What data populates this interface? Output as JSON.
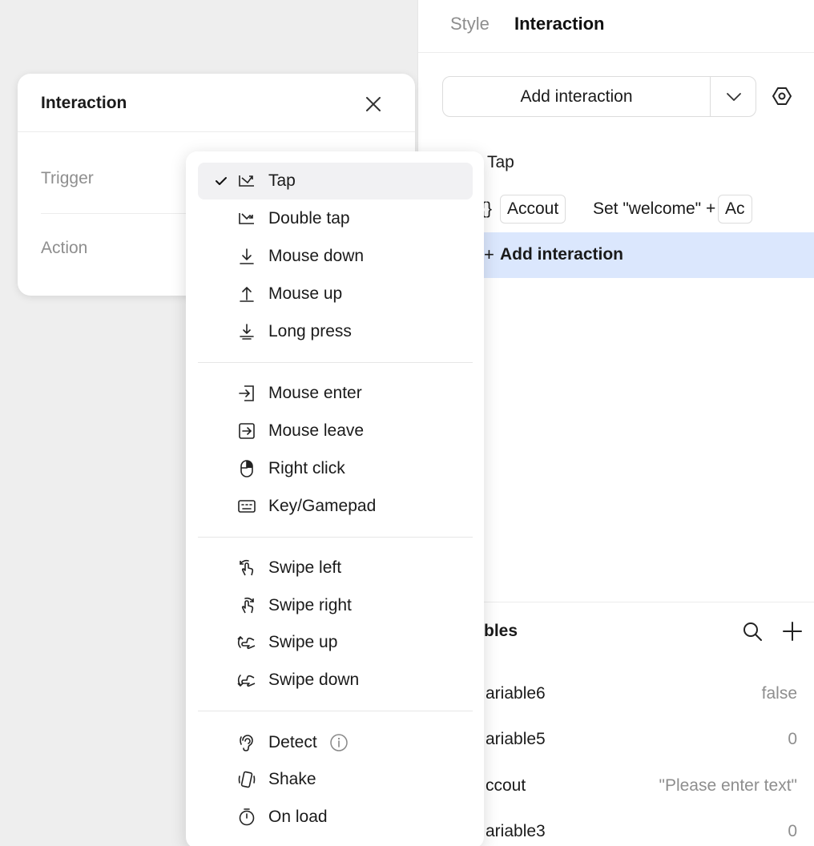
{
  "inspector": {
    "tabs": [
      "Style",
      "Interaction"
    ],
    "add_interaction_label": "Add interaction",
    "trigger_row": "Tap",
    "action_row": {
      "brace": "{}",
      "chip_1": "Accout",
      "text": "Set \"welcome\" +",
      "chip_2": "Ac"
    },
    "add_interaction_row": "Add interaction",
    "variables_title": "bles",
    "variables": [
      {
        "name": "ariable6",
        "value": "false"
      },
      {
        "name": "ariable5",
        "value": "0"
      },
      {
        "name": "ccout",
        "value": "\"Please enter text\""
      },
      {
        "name": "ariable3",
        "value": "0"
      }
    ]
  },
  "card": {
    "title": "Interaction",
    "trigger_label": "Trigger",
    "action_label": "Action"
  },
  "menu": {
    "selected": "Tap",
    "groups": [
      [
        {
          "label": "Tap",
          "icon": "tap-icon"
        },
        {
          "label": "Double tap",
          "icon": "double-tap-icon"
        },
        {
          "label": "Mouse down",
          "icon": "mouse-down-icon"
        },
        {
          "label": "Mouse up",
          "icon": "mouse-up-icon"
        },
        {
          "label": "Long press",
          "icon": "long-press-icon"
        }
      ],
      [
        {
          "label": "Mouse enter",
          "icon": "mouse-enter-icon"
        },
        {
          "label": "Mouse leave",
          "icon": "mouse-leave-icon"
        },
        {
          "label": "Right click",
          "icon": "right-click-icon"
        },
        {
          "label": "Key/Gamepad",
          "icon": "keyboard-icon"
        }
      ],
      [
        {
          "label": "Swipe left",
          "icon": "swipe-left-icon"
        },
        {
          "label": "Swipe right",
          "icon": "swipe-right-icon"
        },
        {
          "label": "Swipe up",
          "icon": "swipe-up-icon"
        },
        {
          "label": "Swipe down",
          "icon": "swipe-down-icon"
        }
      ],
      [
        {
          "label": "Detect",
          "icon": "ear-icon"
        },
        {
          "label": "Shake",
          "icon": "shake-icon"
        },
        {
          "label": "On load",
          "icon": "timer-icon"
        }
      ]
    ]
  }
}
